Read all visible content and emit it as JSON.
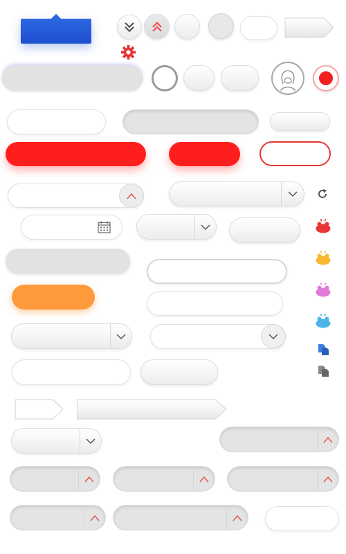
{
  "colors": {
    "accent_red": "#ff1e1e",
    "tooltip_blue": "#1d4fcf",
    "orange": "#ff9a3c",
    "gray_fill": "#e2e2e2",
    "icon_red": "#e83535",
    "icon_yellow": "#f5b82e",
    "icon_pink": "#e07ad8",
    "icon_blue": "#4db4e8",
    "doc_blue": "#3f7fe3",
    "doc_gray": "#777777"
  },
  "icons": {
    "double_down": "chevron-double-down-icon",
    "double_up": "chevron-double-up-icon",
    "settings": "gear-icon",
    "avatar": "user-avatar-icon",
    "record": "record-icon",
    "calendar": "calendar-icon",
    "refresh": "refresh-icon",
    "frogs": [
      "frog-icon-red",
      "frog-icon-yellow",
      "frog-icon-pink",
      "frog-icon-blue"
    ],
    "copy_blue": "copy-document-icon-blue",
    "copy_gray": "copy-document-icon-gray"
  }
}
